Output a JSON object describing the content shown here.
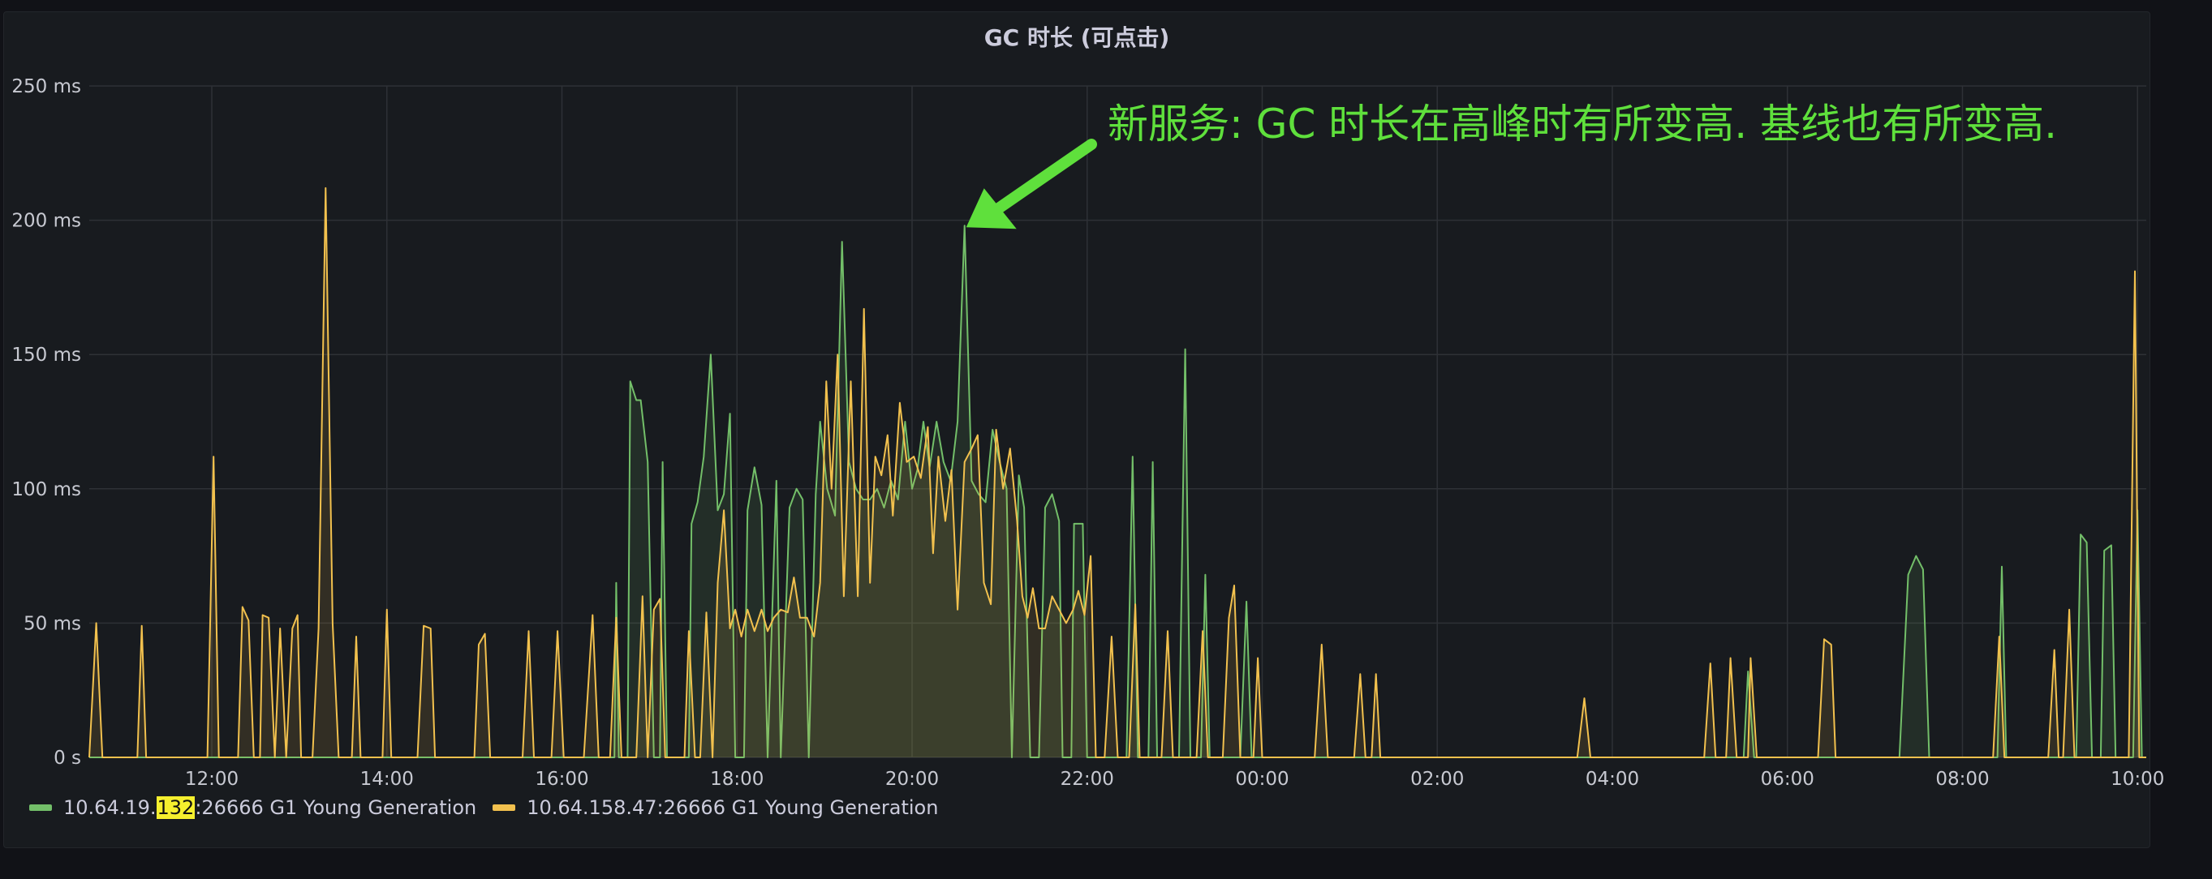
{
  "panel": {
    "title": "GC 时长 (可点击)"
  },
  "chart_data": {
    "type": "line",
    "title": "GC 时长 (可点击)",
    "y_unit": "ms",
    "ylim": [
      0,
      250
    ],
    "yticks": [
      0,
      50,
      100,
      150,
      200,
      250
    ],
    "ytick_labels": [
      "0 s",
      "50 ms",
      "100 ms",
      "150 ms",
      "200 ms",
      "250 ms"
    ],
    "x_range_hours": [
      10.6,
      34.1
    ],
    "xticks": [
      12,
      14,
      16,
      18,
      20,
      22,
      24,
      26,
      28,
      30,
      32,
      34
    ],
    "xtick_labels": [
      "12:00",
      "14:00",
      "16:00",
      "18:00",
      "20:00",
      "22:00",
      "00:00",
      "02:00",
      "04:00",
      "06:00",
      "08:00",
      "10:00"
    ],
    "grid": true,
    "legend_position": "bottom-left",
    "annotation": {
      "text": "新服务: GC 时长在高峰时有所变高. 基线也有所变高.",
      "color": "#5fe03c",
      "points_to_x": 20.6,
      "points_to_y": 198
    },
    "series": [
      {
        "name_parts": [
          "10.64.19.",
          "132",
          ":26666 G1 Young Generation"
        ],
        "color": "#73bf69",
        "fill": true,
        "points": [
          [
            10.6,
            0
          ],
          [
            16.6,
            0
          ],
          [
            16.62,
            65
          ],
          [
            16.65,
            0
          ],
          [
            16.75,
            0
          ],
          [
            16.78,
            140
          ],
          [
            16.85,
            133
          ],
          [
            16.9,
            133
          ],
          [
            16.98,
            110
          ],
          [
            17.05,
            0
          ],
          [
            17.12,
            0
          ],
          [
            17.15,
            110
          ],
          [
            17.2,
            0
          ],
          [
            17.45,
            0
          ],
          [
            17.48,
            87
          ],
          [
            17.55,
            95
          ],
          [
            17.62,
            112
          ],
          [
            17.7,
            150
          ],
          [
            17.78,
            92
          ],
          [
            17.85,
            98
          ],
          [
            17.92,
            128
          ],
          [
            17.98,
            0
          ],
          [
            18.08,
            0
          ],
          [
            18.12,
            92
          ],
          [
            18.2,
            108
          ],
          [
            18.28,
            94
          ],
          [
            18.35,
            0
          ],
          [
            18.45,
            103
          ],
          [
            18.5,
            0
          ],
          [
            18.6,
            93
          ],
          [
            18.68,
            100
          ],
          [
            18.75,
            96
          ],
          [
            18.82,
            0
          ],
          [
            18.9,
            98
          ],
          [
            18.95,
            125
          ],
          [
            19.03,
            100
          ],
          [
            19.12,
            90
          ],
          [
            19.2,
            192
          ],
          [
            19.28,
            110
          ],
          [
            19.36,
            100
          ],
          [
            19.44,
            96
          ],
          [
            19.52,
            96
          ],
          [
            19.6,
            100
          ],
          [
            19.68,
            93
          ],
          [
            19.76,
            103
          ],
          [
            19.84,
            96
          ],
          [
            19.92,
            125
          ],
          [
            20.0,
            100
          ],
          [
            20.06,
            107
          ],
          [
            20.13,
            125
          ],
          [
            20.2,
            108
          ],
          [
            20.28,
            125
          ],
          [
            20.36,
            110
          ],
          [
            20.44,
            103
          ],
          [
            20.52,
            125
          ],
          [
            20.6,
            198
          ],
          [
            20.68,
            103
          ],
          [
            20.76,
            98
          ],
          [
            20.84,
            95
          ],
          [
            20.92,
            122
          ],
          [
            21.0,
            110
          ],
          [
            21.08,
            100
          ],
          [
            21.14,
            0
          ],
          [
            21.22,
            105
          ],
          [
            21.28,
            93
          ],
          [
            21.35,
            0
          ],
          [
            21.45,
            0
          ],
          [
            21.52,
            93
          ],
          [
            21.6,
            98
          ],
          [
            21.68,
            88
          ],
          [
            21.72,
            0
          ],
          [
            21.82,
            0
          ],
          [
            21.85,
            87
          ],
          [
            21.95,
            87
          ],
          [
            22.0,
            0
          ],
          [
            22.15,
            0
          ],
          [
            22.2,
            0
          ],
          [
            22.45,
            0
          ],
          [
            22.52,
            112
          ],
          [
            22.58,
            0
          ],
          [
            22.7,
            0
          ],
          [
            22.75,
            110
          ],
          [
            22.8,
            0
          ],
          [
            23.05,
            0
          ],
          [
            23.12,
            152
          ],
          [
            23.18,
            0
          ],
          [
            23.3,
            0
          ],
          [
            23.35,
            68
          ],
          [
            23.4,
            0
          ],
          [
            23.75,
            0
          ],
          [
            23.82,
            58
          ],
          [
            23.88,
            0
          ],
          [
            29.5,
            0
          ],
          [
            29.55,
            32
          ],
          [
            29.62,
            0
          ],
          [
            31.28,
            0
          ],
          [
            31.38,
            68
          ],
          [
            31.47,
            75
          ],
          [
            31.55,
            70
          ],
          [
            31.62,
            0
          ],
          [
            32.4,
            0
          ],
          [
            32.45,
            71
          ],
          [
            32.5,
            0
          ],
          [
            33.3,
            0
          ],
          [
            33.35,
            83
          ],
          [
            33.42,
            80
          ],
          [
            33.48,
            0
          ],
          [
            33.58,
            0
          ],
          [
            33.62,
            77
          ],
          [
            33.7,
            79
          ],
          [
            33.75,
            0
          ],
          [
            33.95,
            0
          ],
          [
            34.0,
            92
          ],
          [
            34.05,
            0
          ],
          [
            34.1,
            0
          ]
        ]
      },
      {
        "name": "10.64.158.47:26666 G1 Young Generation",
        "color": "#f2c14e",
        "fill": true,
        "points": [
          [
            10.6,
            0
          ],
          [
            10.68,
            50
          ],
          [
            10.75,
            0
          ],
          [
            11.15,
            0
          ],
          [
            11.2,
            49
          ],
          [
            11.25,
            0
          ],
          [
            11.95,
            0
          ],
          [
            12.02,
            112
          ],
          [
            12.08,
            0
          ],
          [
            12.3,
            0
          ],
          [
            12.35,
            56
          ],
          [
            12.42,
            51
          ],
          [
            12.48,
            0
          ],
          [
            12.55,
            0
          ],
          [
            12.58,
            53
          ],
          [
            12.65,
            52
          ],
          [
            12.72,
            0
          ],
          [
            12.78,
            48
          ],
          [
            12.85,
            0
          ],
          [
            12.92,
            48
          ],
          [
            12.98,
            53
          ],
          [
            13.02,
            0
          ],
          [
            13.15,
            0
          ],
          [
            13.22,
            48
          ],
          [
            13.3,
            212
          ],
          [
            13.38,
            50
          ],
          [
            13.45,
            0
          ],
          [
            13.6,
            0
          ],
          [
            13.65,
            45
          ],
          [
            13.7,
            0
          ],
          [
            13.95,
            0
          ],
          [
            14.0,
            55
          ],
          [
            14.05,
            0
          ],
          [
            14.35,
            0
          ],
          [
            14.42,
            49
          ],
          [
            14.5,
            48
          ],
          [
            14.55,
            0
          ],
          [
            15.0,
            0
          ],
          [
            15.05,
            42
          ],
          [
            15.12,
            46
          ],
          [
            15.18,
            0
          ],
          [
            15.55,
            0
          ],
          [
            15.62,
            47
          ],
          [
            15.68,
            0
          ],
          [
            15.88,
            0
          ],
          [
            15.95,
            47
          ],
          [
            16.02,
            0
          ],
          [
            16.25,
            0
          ],
          [
            16.35,
            53
          ],
          [
            16.42,
            0
          ],
          [
            16.55,
            0
          ],
          [
            16.62,
            52
          ],
          [
            16.68,
            0
          ],
          [
            16.85,
            0
          ],
          [
            16.92,
            60
          ],
          [
            16.98,
            0
          ],
          [
            17.05,
            55
          ],
          [
            17.12,
            59
          ],
          [
            17.18,
            0
          ],
          [
            17.4,
            0
          ],
          [
            17.45,
            47
          ],
          [
            17.52,
            0
          ],
          [
            17.58,
            0
          ],
          [
            17.65,
            54
          ],
          [
            17.72,
            0
          ],
          [
            17.78,
            65
          ],
          [
            17.85,
            92
          ],
          [
            17.92,
            48
          ],
          [
            17.98,
            55
          ],
          [
            18.05,
            45
          ],
          [
            18.12,
            55
          ],
          [
            18.2,
            47
          ],
          [
            18.28,
            55
          ],
          [
            18.35,
            47
          ],
          [
            18.42,
            52
          ],
          [
            18.5,
            55
          ],
          [
            18.58,
            54
          ],
          [
            18.65,
            67
          ],
          [
            18.72,
            52
          ],
          [
            18.8,
            52
          ],
          [
            18.88,
            45
          ],
          [
            18.95,
            65
          ],
          [
            19.02,
            140
          ],
          [
            19.08,
            100
          ],
          [
            19.15,
            150
          ],
          [
            19.22,
            60
          ],
          [
            19.3,
            140
          ],
          [
            19.38,
            60
          ],
          [
            19.45,
            167
          ],
          [
            19.52,
            65
          ],
          [
            19.58,
            112
          ],
          [
            19.65,
            105
          ],
          [
            19.72,
            120
          ],
          [
            19.78,
            90
          ],
          [
            19.86,
            132
          ],
          [
            19.94,
            110
          ],
          [
            20.02,
            112
          ],
          [
            20.1,
            104
          ],
          [
            20.18,
            123
          ],
          [
            20.24,
            76
          ],
          [
            20.3,
            112
          ],
          [
            20.38,
            88
          ],
          [
            20.45,
            107
          ],
          [
            20.52,
            55
          ],
          [
            20.6,
            110
          ],
          [
            20.68,
            115
          ],
          [
            20.75,
            120
          ],
          [
            20.82,
            65
          ],
          [
            20.9,
            57
          ],
          [
            20.96,
            122
          ],
          [
            21.04,
            100
          ],
          [
            21.12,
            115
          ],
          [
            21.2,
            88
          ],
          [
            21.26,
            60
          ],
          [
            21.32,
            52
          ],
          [
            21.38,
            63
          ],
          [
            21.45,
            48
          ],
          [
            21.52,
            48
          ],
          [
            21.6,
            60
          ],
          [
            21.68,
            55
          ],
          [
            21.76,
            50
          ],
          [
            21.84,
            55
          ],
          [
            21.9,
            62
          ],
          [
            21.97,
            53
          ],
          [
            22.04,
            75
          ],
          [
            22.1,
            0
          ],
          [
            22.15,
            0
          ],
          [
            22.2,
            0
          ],
          [
            22.28,
            45
          ],
          [
            22.35,
            0
          ],
          [
            22.48,
            0
          ],
          [
            22.55,
            57
          ],
          [
            22.6,
            0
          ],
          [
            22.85,
            0
          ],
          [
            22.92,
            47
          ],
          [
            22.98,
            0
          ],
          [
            23.25,
            0
          ],
          [
            23.32,
            47
          ],
          [
            23.38,
            0
          ],
          [
            23.55,
            0
          ],
          [
            23.62,
            52
          ],
          [
            23.68,
            64
          ],
          [
            23.75,
            0
          ],
          [
            23.9,
            0
          ],
          [
            23.95,
            37
          ],
          [
            24.0,
            0
          ],
          [
            24.6,
            0
          ],
          [
            24.68,
            42
          ],
          [
            24.75,
            0
          ],
          [
            25.05,
            0
          ],
          [
            25.12,
            31
          ],
          [
            25.18,
            0
          ],
          [
            25.25,
            0
          ],
          [
            25.3,
            31
          ],
          [
            25.35,
            0
          ],
          [
            27.6,
            0
          ],
          [
            27.68,
            22
          ],
          [
            27.75,
            0
          ],
          [
            29.05,
            0
          ],
          [
            29.12,
            35
          ],
          [
            29.18,
            0
          ],
          [
            29.3,
            0
          ],
          [
            29.35,
            37
          ],
          [
            29.42,
            0
          ],
          [
            29.55,
            0
          ],
          [
            29.58,
            37
          ],
          [
            29.65,
            0
          ],
          [
            30.35,
            0
          ],
          [
            30.42,
            44
          ],
          [
            30.5,
            42
          ],
          [
            30.55,
            0
          ],
          [
            31.6,
            0
          ],
          [
            31.65,
            0
          ],
          [
            32.35,
            0
          ],
          [
            32.42,
            45
          ],
          [
            32.48,
            0
          ],
          [
            32.98,
            0
          ],
          [
            33.05,
            40
          ],
          [
            33.1,
            0
          ],
          [
            33.15,
            0
          ],
          [
            33.22,
            55
          ],
          [
            33.28,
            0
          ],
          [
            33.9,
            0
          ],
          [
            33.97,
            181
          ],
          [
            34.02,
            0
          ],
          [
            34.1,
            0
          ]
        ]
      }
    ]
  }
}
